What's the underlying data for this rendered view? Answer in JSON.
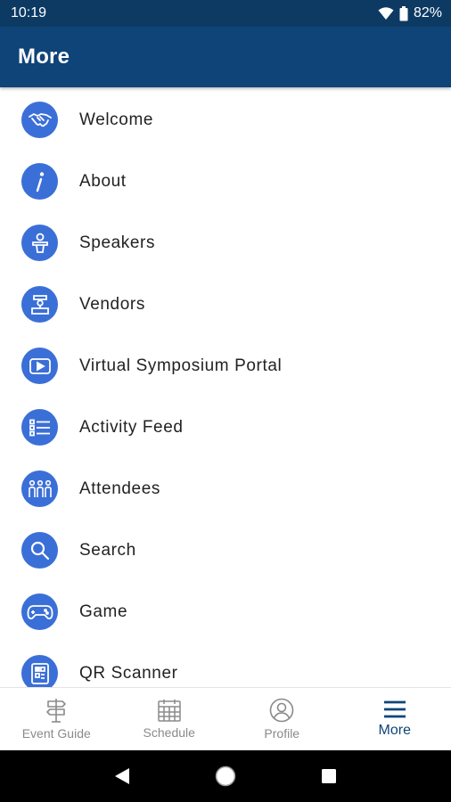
{
  "status_bar": {
    "time": "10:19",
    "battery": "82%"
  },
  "app_bar": {
    "title": "More"
  },
  "menu": {
    "items": [
      {
        "label": "Welcome",
        "icon": "handshake-icon"
      },
      {
        "label": "About",
        "icon": "info-icon"
      },
      {
        "label": "Speakers",
        "icon": "speaker-podium-icon"
      },
      {
        "label": "Vendors",
        "icon": "vendor-booth-icon"
      },
      {
        "label": "Virtual Symposium Portal",
        "icon": "video-play-icon"
      },
      {
        "label": "Activity Feed",
        "icon": "list-feed-icon"
      },
      {
        "label": "Attendees",
        "icon": "people-group-icon"
      },
      {
        "label": "Search",
        "icon": "search-icon"
      },
      {
        "label": "Game",
        "icon": "gamepad-icon"
      },
      {
        "label": "QR Scanner",
        "icon": "qr-scanner-icon"
      }
    ]
  },
  "bottom_nav": {
    "tabs": [
      {
        "label": "Event Guide",
        "icon": "signpost-icon",
        "active": false
      },
      {
        "label": "Schedule",
        "icon": "calendar-icon",
        "active": false
      },
      {
        "label": "Profile",
        "icon": "profile-icon",
        "active": false
      },
      {
        "label": "More",
        "icon": "hamburger-menu-icon",
        "active": true
      }
    ]
  },
  "colors": {
    "status_bar": "#0d3a63",
    "app_bar": "#0f4478",
    "icon_circle": "#3b6fd8",
    "active_tab": "#0f4478",
    "inactive_tab": "#8a8a8a"
  }
}
